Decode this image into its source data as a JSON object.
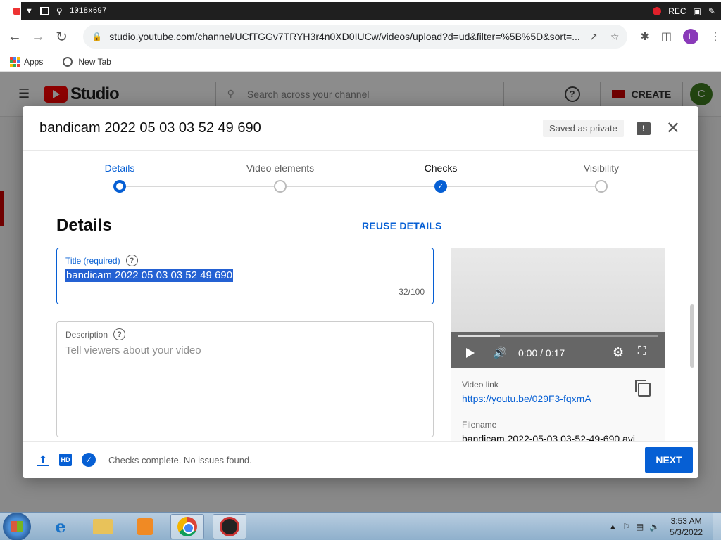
{
  "recorder": {
    "dimensions": "1018x697",
    "rec_label": "REC",
    "icons": [
      "dropdown-arrow-icon",
      "window-icon",
      "search-icon",
      "record-dot-icon",
      "camera-icon",
      "pencil-icon"
    ]
  },
  "browser": {
    "url": "studio.youtube.com/channel/UCfTGGv7TRYH3r4n0XD0IUCw/videos/upload?d=ud&filter=%5B%5D&sort=...",
    "profile_initial": "L",
    "bookmarks": [
      {
        "label": "Apps"
      },
      {
        "label": "New Tab"
      }
    ]
  },
  "studio": {
    "logo_text": "Studio",
    "search_placeholder": "Search across your channel",
    "create_label": "CREATE",
    "avatar_initial": "C"
  },
  "dialog": {
    "title": "bandicam 2022 05 03 03 52 49 690",
    "saved_badge": "Saved as private",
    "steps": [
      {
        "label": "Details",
        "state": "active"
      },
      {
        "label": "Video elements",
        "state": "pending"
      },
      {
        "label": "Checks",
        "state": "done"
      },
      {
        "label": "Visibility",
        "state": "pending"
      }
    ],
    "section_title": "Details",
    "reuse_label": "REUSE DETAILS",
    "title_field": {
      "label": "Title (required)",
      "value": "bandicam 2022 05 03 03 52 49 690",
      "counter": "32/100"
    },
    "description_field": {
      "label": "Description",
      "placeholder": "Tell viewers about your video"
    },
    "preview": {
      "time": "0:00 / 0:17",
      "video_link_label": "Video link",
      "video_link": "https://youtu.be/029F3-fqxmA",
      "filename_label": "Filename",
      "filename": "bandicam 2022-05-03 03-52-49-690.avi"
    },
    "footer": {
      "status": "Checks complete. No issues found.",
      "next_label": "NEXT"
    }
  },
  "taskbar": {
    "time": "3:53 AM",
    "date": "5/3/2022"
  },
  "colors": {
    "accent": "#065fd4",
    "youtube_red": "#ff0000",
    "selection": "#2461d3"
  }
}
